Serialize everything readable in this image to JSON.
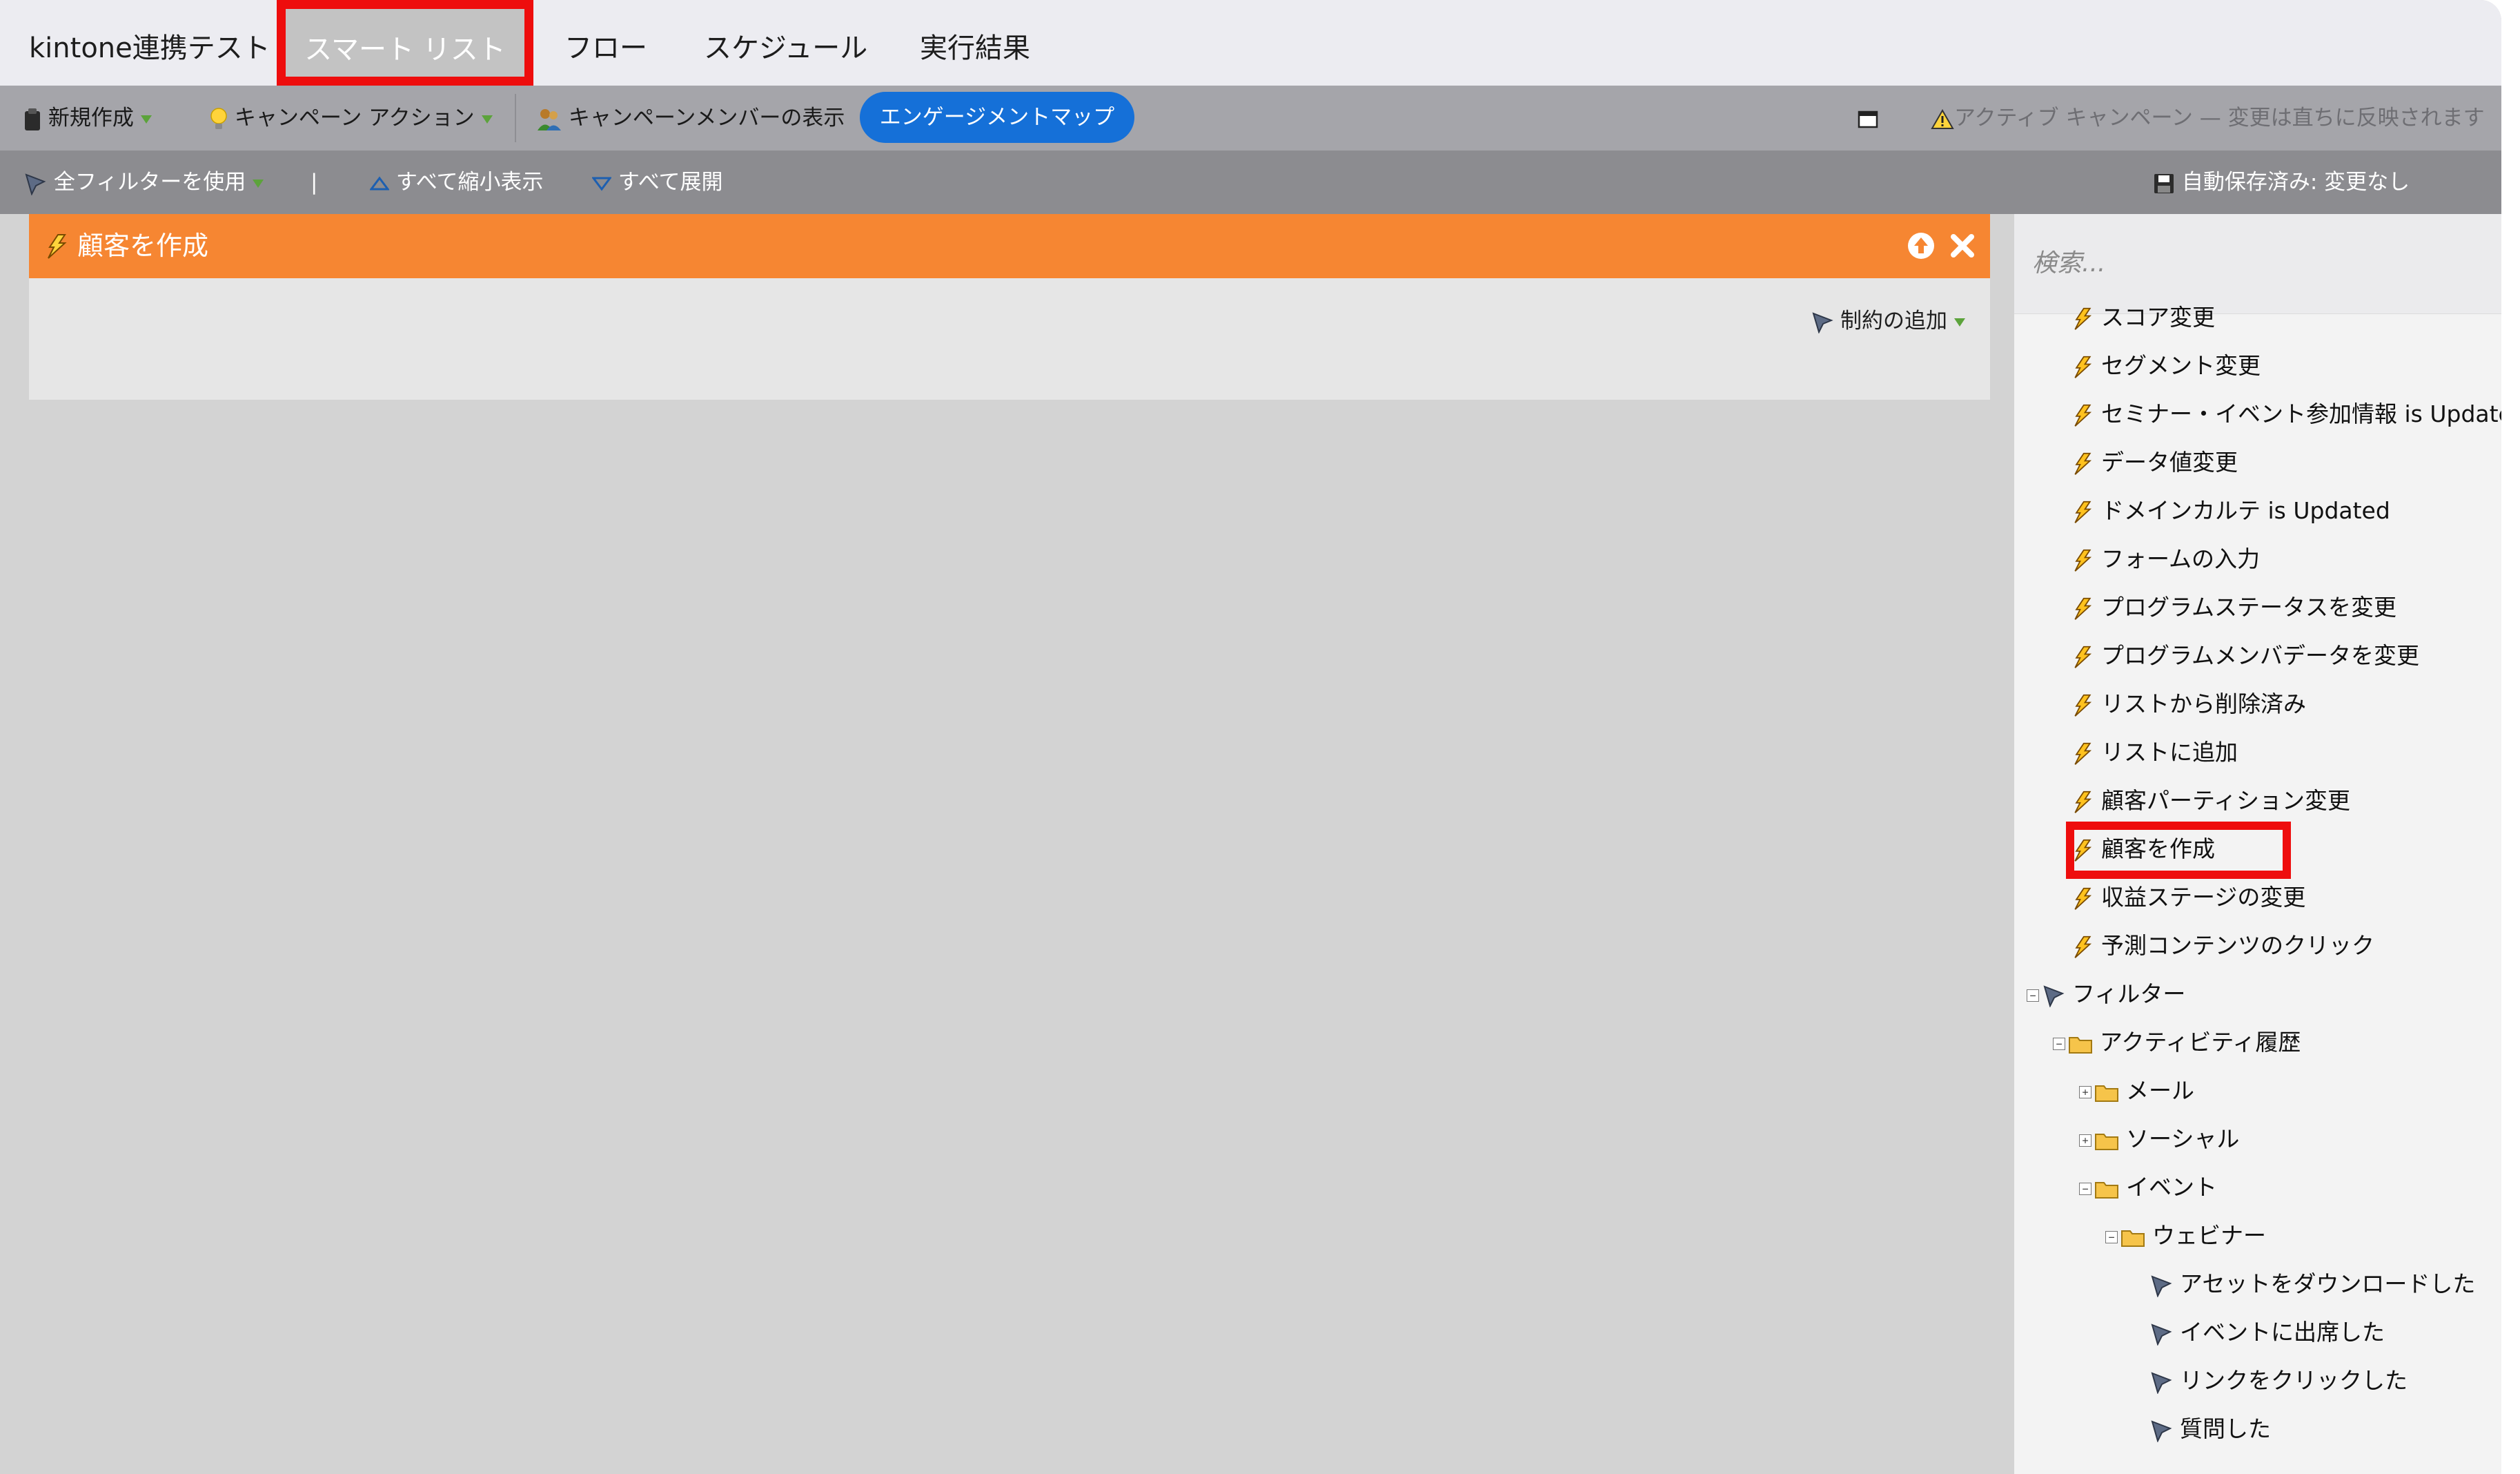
{
  "tabs": [
    {
      "label": "kintone連携テスト",
      "active": false
    },
    {
      "label": "スマート リスト",
      "active": true
    },
    {
      "label": "フロー",
      "active": false
    },
    {
      "label": "スケジュール",
      "active": false
    },
    {
      "label": "実行結果",
      "active": false
    }
  ],
  "toolbar": {
    "new_label": "新規作成",
    "campaign_action_label": "キャンペーン アクション",
    "view_members_label": "キャンペーンメンバーの表示",
    "engagement_map_label": "エンゲージメントマップ",
    "warning_text": "アクティブ キャンペーン — 変更は直ちに反映されます"
  },
  "toolbar2": {
    "use_all_filters_label": "全フィルターを使用",
    "separator": "|",
    "collapse_all_label": "すべて縮小表示",
    "expand_all_label": "すべて展開",
    "autosave_label": "自動保存済み: 変更なし"
  },
  "panel": {
    "title": "顧客を作成",
    "add_constraint_label": "制約の追加"
  },
  "search": {
    "placeholder": "検索..."
  },
  "tree": {
    "triggers": [
      "スコア変更",
      "セグメント変更",
      "セミナー・イベント参加情報 is Updated",
      "データ値変更",
      "ドメインカルテ is Updated",
      "フォームの入力",
      "プログラムステータスを変更",
      "プログラムメンバデータを変更",
      "リストから削除済み",
      "リストに追加",
      "顧客パーティション変更",
      "顧客を作成",
      "収益ステージの変更",
      "予測コンテンツのクリック"
    ],
    "filters_label": "フィルター",
    "activity_history_label": "アクティビティ履歴",
    "email_label": "メール",
    "social_label": "ソーシャル",
    "event_label": "イベント",
    "webinar_label": "ウェビナー",
    "webinar_items": [
      "アセットをダウンロードした",
      "イベントに出席した",
      "リンクをクリックした",
      "質問した"
    ]
  },
  "colors": {
    "highlight": "#ee0d0d",
    "panel_header": "#f68632",
    "accent": "#1570d8"
  }
}
